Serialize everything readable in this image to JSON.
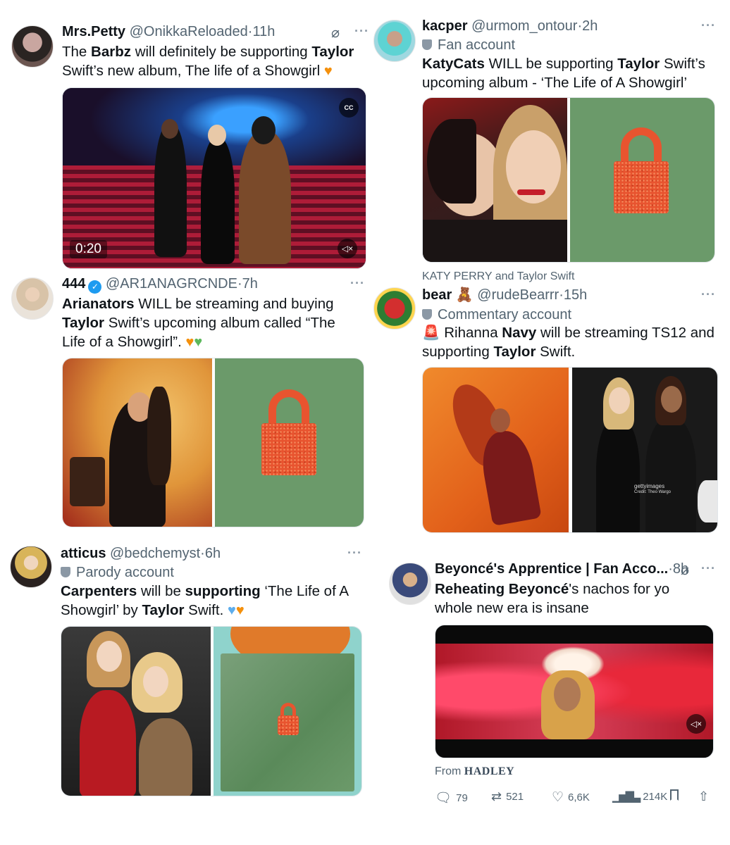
{
  "tweets": {
    "t1": {
      "name": "Mrs.Petty",
      "handle": "@OnikkaReloaded",
      "time": "11h",
      "text": {
        "p1": "The ",
        "b1": "Barbz",
        "p2": " will definitely be supporting ",
        "b2": "Taylor",
        "p3": " Swift’s new album, The life of a Showgirl "
      },
      "video_time": "0:20"
    },
    "t2": {
      "name": "kacper",
      "handle": "@urmom_ontour",
      "time": "2h",
      "label": "Fan account",
      "text": {
        "b1": "KatyCats",
        "p1": " WILL be supporting ",
        "b2": "Taylor",
        "p2": " Swift’s upcoming album - ‘The Life of A Showgirl’"
      },
      "media_caption": "KATY PERRY and Taylor Swift"
    },
    "t3": {
      "name": "444",
      "handle": "@AR1ANAGRCNDE",
      "time": "7h",
      "text": {
        "b1": "Arianators",
        "p1": " WILL be streaming and buying ",
        "b2": "Taylor",
        "p2": " Swift’s upcoming album called “The Life of a Showgirl”. "
      }
    },
    "t4": {
      "name": "bear",
      "name_emoji": "🧸",
      "handle": "@rudeBearrr",
      "time": "15h",
      "label": "Commentary account",
      "text": {
        "siren": "🚨",
        "p1": " Rihanna ",
        "b1": "Navy",
        "p2": " will be streaming TS12 and supporting ",
        "b2": "Taylor",
        "p3": " Swift."
      },
      "getty": "gettyimages",
      "getty_credit": "Credit: Theo Wargo"
    },
    "t5": {
      "name": "atticus",
      "handle": "@bedchemyst",
      "time": "6h",
      "label": "Parody account",
      "text": {
        "b1": "Carpenters",
        "p1": " will be ",
        "b2": "supporting",
        "p2": " ‘The Life of A Showgirl’ by ",
        "b3": "Taylor",
        "p3": " Swift. "
      }
    },
    "t6": {
      "name": "Beyoncé's Apprentice | Fan Acco...",
      "time": "8h",
      "text": {
        "b1": "Reheating Beyoncé",
        "p1": "'s nachos for yo whole new era is insane"
      },
      "from_label": "From",
      "from_source": "HADLEY",
      "actions": {
        "replies": "79",
        "reposts": "521",
        "likes": "6,6K",
        "views": "214K"
      }
    }
  },
  "common": {
    "dot": "·",
    "more": "···"
  },
  "colors": {
    "accent": "#1d9bf0",
    "lock": "#e8542f",
    "green_bg": "#6b9a6a"
  }
}
